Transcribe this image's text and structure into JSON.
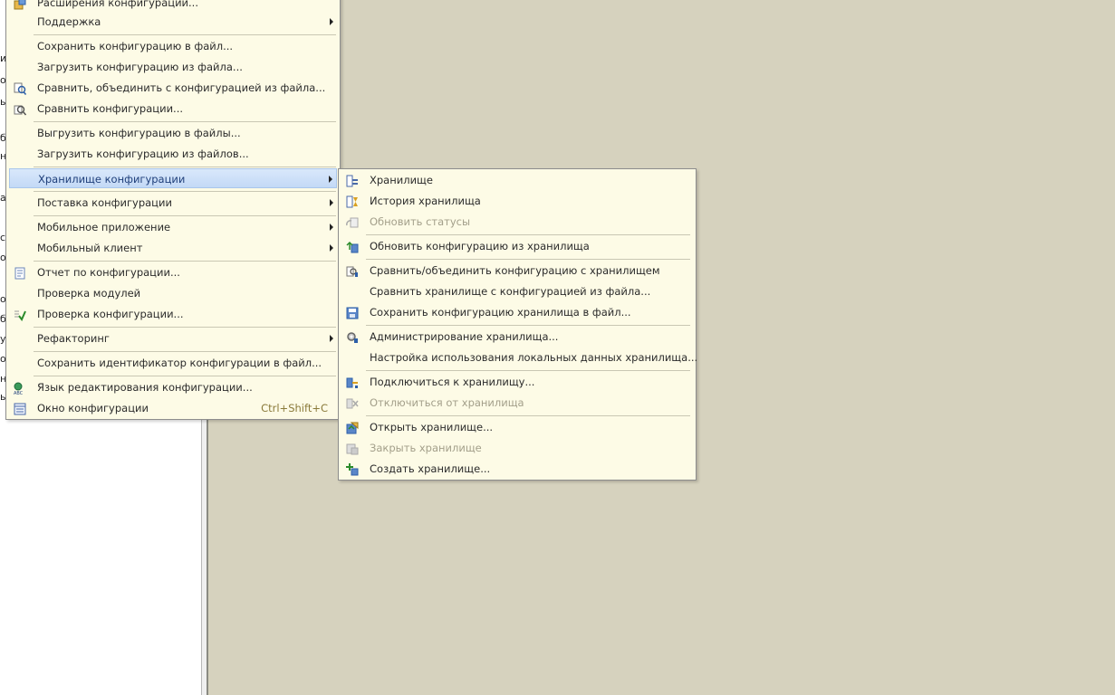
{
  "left_panel": {
    "fragments": [
      "ик",
      "од",
      "ы",
      "б",
      "н",
      "а",
      "ст",
      "о",
      "о",
      "б",
      "у",
      "ог",
      "но",
      "ы",
      "ы",
      "ия",
      "сд"
    ]
  },
  "main_menu": {
    "top_partial": "Расширения конфигурации...",
    "items": [
      {
        "label": "Поддержка",
        "arrow": true
      },
      {
        "label": "Сохранить конфигурацию в файл..."
      },
      {
        "label": "Загрузить конфигурацию из файла..."
      },
      {
        "label": "Сравнить, объединить с конфигурацией из файла...",
        "icon": "compare-merge-icon"
      },
      {
        "label": "Сравнить конфигурации...",
        "icon": "compare-icon"
      },
      {
        "label": "Выгрузить конфигурацию в файлы..."
      },
      {
        "label": "Загрузить конфигурацию из файлов..."
      },
      {
        "label": "Хранилище конфигурации",
        "arrow": true,
        "highlighted": true
      },
      {
        "label": "Поставка конфигурации",
        "arrow": true
      },
      {
        "label": "Мобильное приложение",
        "arrow": true
      },
      {
        "label": "Мобильный клиент",
        "arrow": true
      },
      {
        "label": "Отчет по конфигурации...",
        "icon": "report-icon"
      },
      {
        "label": "Проверка модулей"
      },
      {
        "label": "Проверка конфигурации...",
        "icon": "check-icon"
      },
      {
        "label": "Рефакторинг",
        "arrow": true
      },
      {
        "label": "Сохранить идентификатор конфигурации в файл..."
      },
      {
        "label": "Язык редактирования конфигурации...",
        "icon": "language-icon"
      },
      {
        "label": "Окно конфигурации",
        "shortcut": "Ctrl+Shift+C",
        "icon": "config-window-icon"
      }
    ]
  },
  "sub_menu": {
    "items": [
      {
        "label": "Хранилище",
        "icon": "repository-icon"
      },
      {
        "label": "История хранилища",
        "icon": "repository-history-icon"
      },
      {
        "label": "Обновить статусы",
        "icon": "refresh-status-icon",
        "disabled": true
      },
      {
        "label": "Обновить конфигурацию из хранилища",
        "icon": "update-from-repo-icon"
      },
      {
        "label": "Сравнить/объединить конфигурацию с хранилищем",
        "icon": "compare-repo-icon"
      },
      {
        "label": "Сравнить хранилище с конфигурацией из файла..."
      },
      {
        "label": "Сохранить конфигурацию хранилища в файл...",
        "icon": "save-repo-icon"
      },
      {
        "label": "Администрирование хранилища...",
        "icon": "admin-gear-icon"
      },
      {
        "label": "Настройка использования локальных данных хранилища..."
      },
      {
        "label": "Подключиться к хранилищу...",
        "icon": "connect-icon"
      },
      {
        "label": "Отключиться от хранилища",
        "icon": "disconnect-icon",
        "disabled": true
      },
      {
        "label": "Открыть хранилище...",
        "icon": "open-repo-icon"
      },
      {
        "label": "Закрыть хранилище",
        "icon": "close-repo-icon",
        "disabled": true
      },
      {
        "label": "Создать хранилище...",
        "icon": "create-repo-icon"
      }
    ]
  },
  "colors": {
    "menu_bg": "#fdfbe6",
    "highlight": "#c3d9f6",
    "workspace": "#d6d2be",
    "disabled_text": "#a39f8a"
  }
}
